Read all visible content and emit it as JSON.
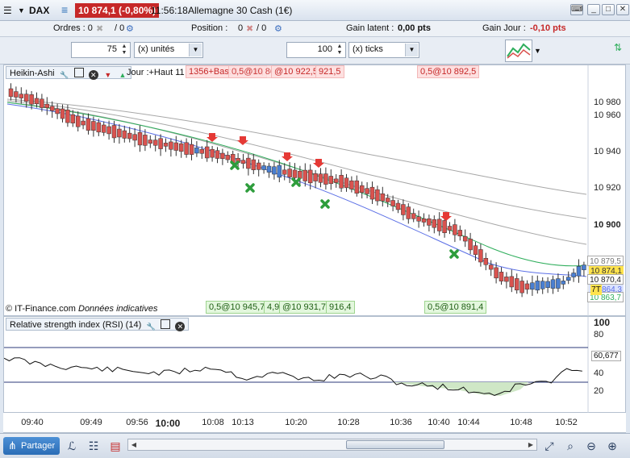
{
  "window": {
    "symbol": "DAX",
    "price_badge": "10 874,1 (-0,80%)",
    "time": "11:56:18",
    "instrument": "Allemagne 30 Cash (1€)"
  },
  "infobar": {
    "orders_label": "Ordres : 0",
    "orders_sep": "/ 0",
    "position_label": "Position :",
    "position_value": "0",
    "latent_label": "Gain latent :",
    "latent_value": "0,00 pts",
    "day_label": "Gain Jour :",
    "day_value": "-0,10 pts"
  },
  "toolbar": {
    "qty_value": "75",
    "qty_unit": "(x) unités",
    "ticks_value": "100",
    "ticks_unit": "(x) ticks"
  },
  "price_panel": {
    "title": "Heikin-Ashi",
    "ohlc_prefix": "Jour :+Haut 11",
    "ohlc_rest": "0,5@10 863,0",
    "ohlc_overlap": "1356+Bas: 10 846,",
    "label_red_1": "@10 922,5",
    "label_red_2": "921,5",
    "label_red_3": "0,5@10 892,5",
    "label_green_1": "0,5@10 945,7",
    "label_green_2": "4,9",
    "label_green_3": "@10 931,7",
    "label_green_4": "916,4",
    "label_green_5": "0,5@10 891,4",
    "copyright": "© IT-Finance.com",
    "copyright_note": "Données indicatives",
    "y_ticks": [
      "10 980",
      "10 960",
      "10 940",
      "10 920",
      "10 900"
    ],
    "tag_1": "10 879,5",
    "tag_2": "10 874,1",
    "tag_3": "10 870,4",
    "tag_4": "10 864,3",
    "tag_5": "10 863,7",
    "tag_7t": "7T"
  },
  "rsi_panel": {
    "title": "Relative strength index (RSI) (14)",
    "y_ticks": [
      "100",
      "80",
      "60,677",
      "40",
      "20"
    ]
  },
  "time_axis": [
    "09:40",
    "09:49",
    "09:56",
    "10:00",
    "10:08",
    "10:13",
    "10:20",
    "10:28",
    "10:36",
    "10:40",
    "10:44",
    "10:48",
    "10:52"
  ],
  "bottombar": {
    "share_label": "Partager"
  },
  "colors": {
    "bull": "#4a7fd1",
    "bear": "#d9534f",
    "ma_green": "#2fae5c",
    "ma_blue": "#5b6fe6",
    "ma_grey": "#a7a7a7"
  }
}
